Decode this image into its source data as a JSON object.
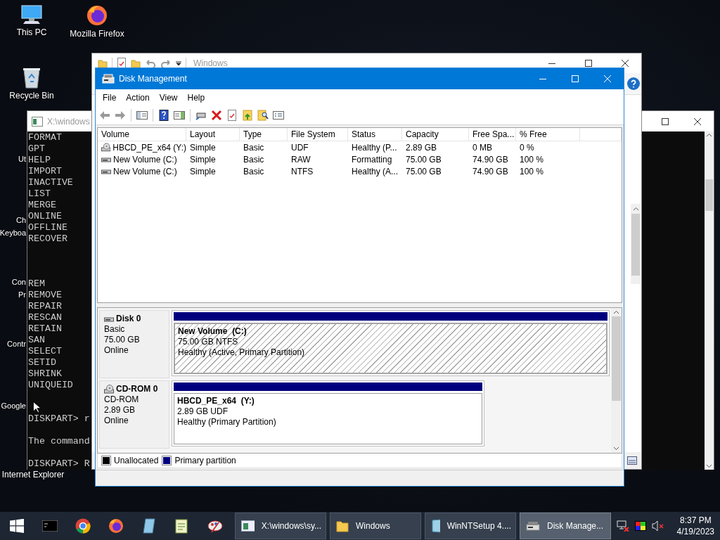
{
  "desktop_icons": [
    {
      "kind": "pc",
      "lines": [
        "This PC"
      ]
    },
    {
      "kind": "browser",
      "lines": [
        "Mozilla Firefox"
      ]
    },
    {
      "kind": "bin",
      "lines": [
        "Recycle Bin"
      ]
    },
    {
      "kind": "label",
      "lines": [
        "Ut"
      ]
    },
    {
      "kind": "label",
      "lines": [
        "Ch",
        "Keyboa"
      ]
    },
    {
      "kind": "label",
      "lines": [
        "Con",
        "Pr"
      ]
    },
    {
      "kind": "label",
      "lines": [
        "Contr"
      ]
    },
    {
      "kind": "label",
      "lines": [
        "Google"
      ]
    },
    {
      "kind": "label",
      "lines": [
        "Internet Explorer"
      ]
    }
  ],
  "console_window": {
    "title": "X:\\windows",
    "blocks": [
      [
        "FORMAT",
        "GPT",
        "HELP",
        "IMPORT",
        "INACTIVE",
        "LIST",
        "MERGE",
        "ONLINE",
        "OFFLINE",
        "RECOVER"
      ],
      [
        "REM",
        "REMOVE",
        "REPAIR",
        "RESCAN",
        "RETAIN",
        "SAN",
        "SELECT",
        "SETID",
        "SHRINK",
        "UNIQUEID"
      ],
      [
        "DISKPART> r"
      ],
      [
        "The command"
      ],
      [
        "DISKPART> R"
      ]
    ]
  },
  "explorer_window": {
    "title": "Windows"
  },
  "disk_management": {
    "title": "Disk Management",
    "menu": [
      "File",
      "Action",
      "View",
      "Help"
    ],
    "volume_table": {
      "columns": [
        "Volume",
        "Layout",
        "Type",
        "File System",
        "Status",
        "Capacity",
        "Free Spa...",
        "% Free"
      ],
      "rows": [
        {
          "kind": "cdrom",
          "cells": [
            "HBCD_PE_x64 (Y:)",
            "Simple",
            "Basic",
            "UDF",
            "Healthy (P...",
            "2.89 GB",
            "0 MB",
            "0 %"
          ]
        },
        {
          "kind": "disk",
          "cells": [
            "New Volume (C:)",
            "Simple",
            "Basic",
            "RAW",
            "Formatting",
            "75.00 GB",
            "74.90 GB",
            "100 %"
          ]
        },
        {
          "kind": "disk",
          "cells": [
            "New Volume (C:)",
            "Simple",
            "Basic",
            "NTFS",
            "Healthy (A...",
            "75.00 GB",
            "74.90 GB",
            "100 %"
          ]
        }
      ]
    },
    "disks": [
      {
        "kind": "disk",
        "name": "Disk 0",
        "type": "Basic",
        "size": "75.00 GB",
        "status": "Online",
        "partition": {
          "name": "New Volume  (C:)",
          "size": "75.00 GB NTFS",
          "status": "Healthy (Active, Primary Partition)",
          "selected": true
        }
      },
      {
        "kind": "cdrom",
        "name": "CD-ROM 0",
        "type": "CD-ROM",
        "size": "2.89 GB",
        "status": "Online",
        "partition": {
          "name": "HBCD_PE_x64  (Y:)",
          "size": "2.89 GB UDF",
          "status": "Healthy (Primary Partition)",
          "selected": false
        }
      }
    ],
    "legend": [
      {
        "label": "Unallocated",
        "color": "#000000"
      },
      {
        "label": "Primary partition",
        "color": "#00007f"
      }
    ]
  },
  "taskbar": {
    "tasks": [
      {
        "kind": "console",
        "label": "X:\\windows\\sy...",
        "selected": false
      },
      {
        "kind": "folder",
        "label": "Windows",
        "selected": false
      },
      {
        "kind": "setup",
        "label": "WinNTSetup 4....",
        "selected": false
      },
      {
        "kind": "disk",
        "label": "Disk Manage...",
        "selected": true
      }
    ],
    "time": "8:37 PM",
    "date": "4/19/2023"
  }
}
